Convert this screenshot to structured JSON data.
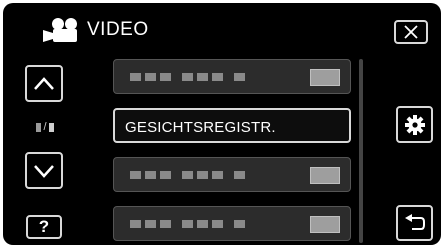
{
  "header": {
    "title": "VIDEO",
    "mode_icon": "video-camera-icon"
  },
  "left_controls": {
    "up_icon": "chevron-up-icon",
    "down_icon": "chevron-down-icon",
    "page_separator": "/",
    "help_label": "?"
  },
  "right_controls": {
    "close_icon": "close-icon",
    "settings_icon": "gear-icon",
    "back_icon": "return-icon"
  },
  "menu": {
    "items": [
      {
        "label": "",
        "state": "unavailable"
      },
      {
        "label": "GESICHTSREGISTR.",
        "state": "selected"
      },
      {
        "label": "",
        "state": "unavailable"
      },
      {
        "label": "",
        "state": "unavailable"
      }
    ]
  },
  "colors": {
    "background": "#000000",
    "button_border": "#d9d9d9",
    "item_bg": "#2c2c2c"
  }
}
